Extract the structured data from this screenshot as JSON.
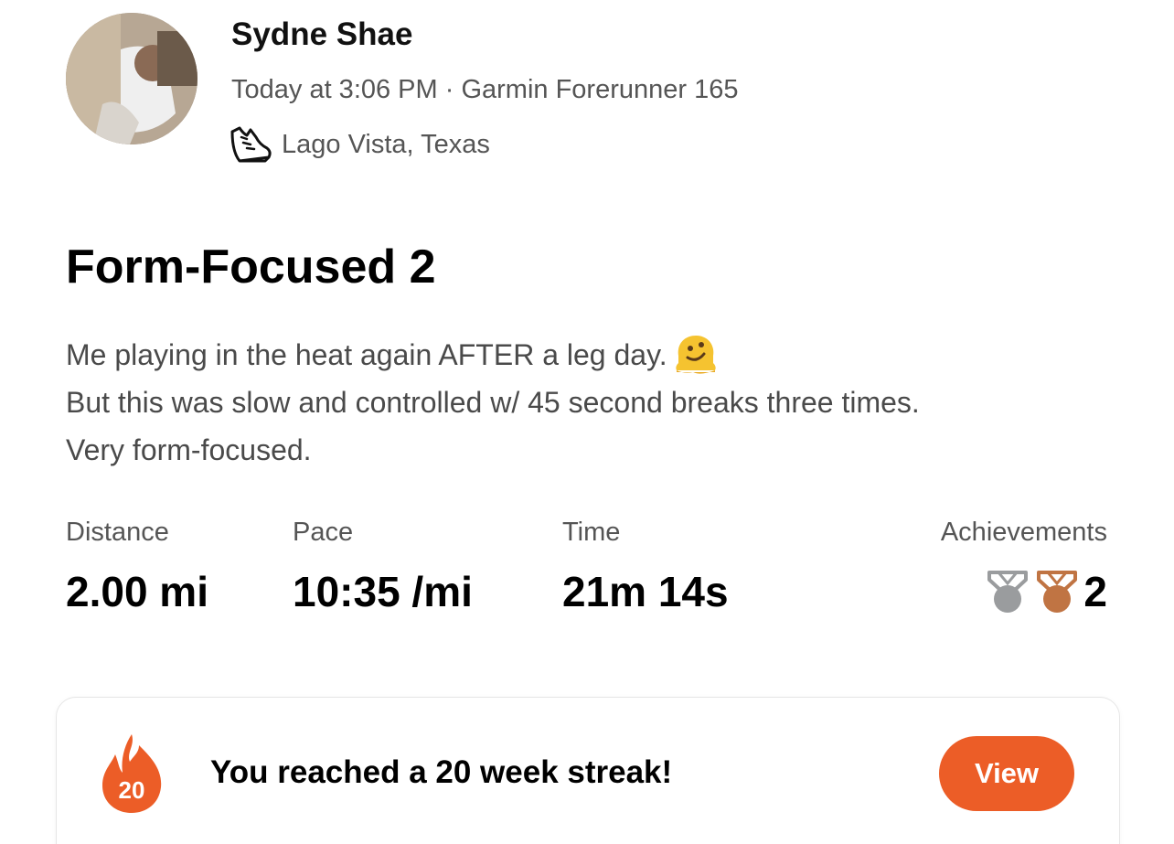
{
  "athlete": {
    "name": "Sydne Shae",
    "meta": "Today at 3:06 PM · Garmin Forerunner 165",
    "location": "Lago Vista, Texas",
    "activity_icon": "running-shoe-icon"
  },
  "activity": {
    "title": "Form-Focused 2",
    "description_lines": [
      "Me playing in the heat again AFTER a leg day.",
      "But this was slow and controlled w/ 45 second breaks three times.",
      "Very form-focused."
    ],
    "emoji": "melting-face-icon"
  },
  "stats": {
    "distance": {
      "label": "Distance",
      "value": "2.00 mi"
    },
    "pace": {
      "label": "Pace",
      "value": "10:35 /mi"
    },
    "time": {
      "label": "Time",
      "value": "21m 14s"
    },
    "achievements": {
      "label": "Achievements",
      "count": "2",
      "medals": [
        {
          "icon": "silver-medal-icon",
          "color": "#9a9c9e"
        },
        {
          "icon": "bronze-medal-icon",
          "color": "#c07443"
        }
      ]
    }
  },
  "streak": {
    "weeks": "20",
    "message": "You reached a 20 week streak!",
    "button_label": "View",
    "accent_color": "#ec5d27"
  }
}
